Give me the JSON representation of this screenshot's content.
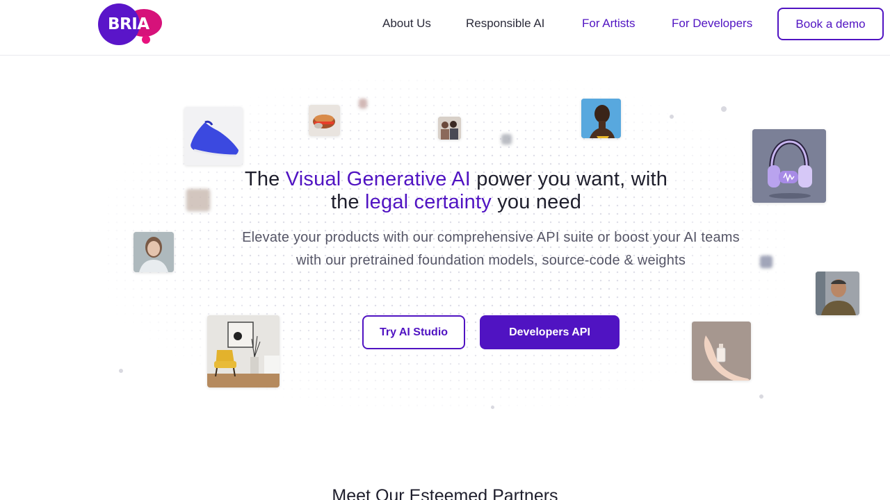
{
  "header": {
    "logo_text": "BRIA",
    "nav": [
      {
        "label": "About Us"
      },
      {
        "label": "Responsible AI"
      },
      {
        "label": "For Artists"
      },
      {
        "label": "For Developers"
      }
    ],
    "cta_label": "Book a demo"
  },
  "hero": {
    "headline_part1": "The ",
    "headline_highlight1": "Visual Generative AI",
    "headline_part2": " power you want, with",
    "headline_part3": "the ",
    "headline_highlight2": "legal certainty",
    "headline_part4": " you need",
    "subtitle": "Elevate your products with our comprehensive API suite or boost your AI teams with our pretrained foundation models, source-code & weights",
    "primary_cta": "Try AI Studio",
    "secondary_cta": "Developers API"
  },
  "partners": {
    "title": "Meet Our Esteemed Partners"
  },
  "colors": {
    "brand_purple": "#5013c2",
    "brand_pink": "#d6127a"
  }
}
